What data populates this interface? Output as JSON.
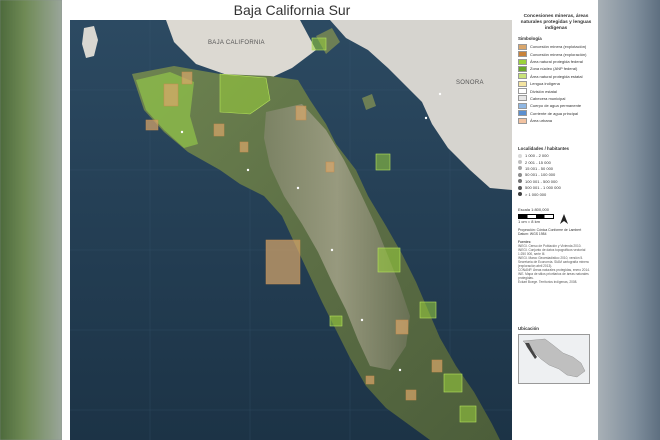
{
  "map": {
    "title": "Baja California Sur",
    "labels": {
      "baja_california": "BAJA CALIFORNIA",
      "sonora": "SONORA"
    }
  },
  "legend": {
    "title": "Concesiones mineras, áreas naturales protegidas y lenguas indígenas",
    "simbologia_heading": "Simbología",
    "items": [
      {
        "label": "Concesión minera (explotación)",
        "color": "#d9a66b"
      },
      {
        "label": "Concesión minera (exploración)",
        "color": "#c8823a"
      },
      {
        "label": "Área natural protegida federal",
        "color": "#9bd23c"
      },
      {
        "label": "Zona núcleo (ANP federal)",
        "color": "#6aa82a"
      },
      {
        "label": "Área natural protegida estatal",
        "color": "#c9e27a"
      },
      {
        "label": "Lengua indígena",
        "color": "#f4e4a1"
      },
      {
        "label": "División estatal",
        "color": "#ffffff"
      },
      {
        "label": "Cabecera municipal",
        "color": "#e6e6e6"
      },
      {
        "label": "Cuerpo de agua permanente",
        "color": "#8fb7e3"
      },
      {
        "label": "Corriente de agua principal",
        "color": "#5a8fd0"
      },
      {
        "label": "Área urbana",
        "color": "#f2c2a0"
      }
    ],
    "localidades_heading": "Localidades / habitantes",
    "localidades": [
      {
        "label": "1 000 - 2 000",
        "color": "#d9d9d9"
      },
      {
        "label": "2 001 - 15 000",
        "color": "#bfbfbf"
      },
      {
        "label": "15 001 - 50 000",
        "color": "#a6a6a6"
      },
      {
        "label": "50 001 - 100 000",
        "color": "#8c8c8c"
      },
      {
        "label": "100 001 - 500 000",
        "color": "#737373"
      },
      {
        "label": "500 001 - 1 000 000",
        "color": "#595959"
      },
      {
        "label": "> 1 000 000",
        "color": "#404040"
      }
    ],
    "scale_text": "Escala 1:800,000",
    "scale_sub": "1 cm = 8 km",
    "projection": "Proyección: Cónica Conforme de Lambert",
    "datum": "Datum: WGS 1984",
    "sources_heading": "Fuentes:",
    "sources": [
      "INEGI. Censo de Población y Vivienda 2010.",
      "INEGI. Conjunto de datos topográficos vectorial 1:250 000, serie III.",
      "INEGI. Marco Geoestadístico 2010, versión 5.",
      "Secretaría de Economía. SIAM cartografía minera (exploración abril 2013).",
      "CONANP. Áreas naturales protegidas, enero 2014.",
      "INE. Mapa de sitios prioritarios de áreas naturales protegidas.",
      "Eckart Boege. Territorios indígenas, 2008."
    ],
    "ubicacion_heading": "Ubicación"
  },
  "colors": {
    "ocean": "#243f55",
    "ocean_deep": "#1c3346",
    "land_desert": "#5f7448",
    "land_mountain": "#8a8a6e",
    "mainland": "#d8d6d2",
    "anp_green": "#9bd23c",
    "mining": "#d9a66b"
  }
}
